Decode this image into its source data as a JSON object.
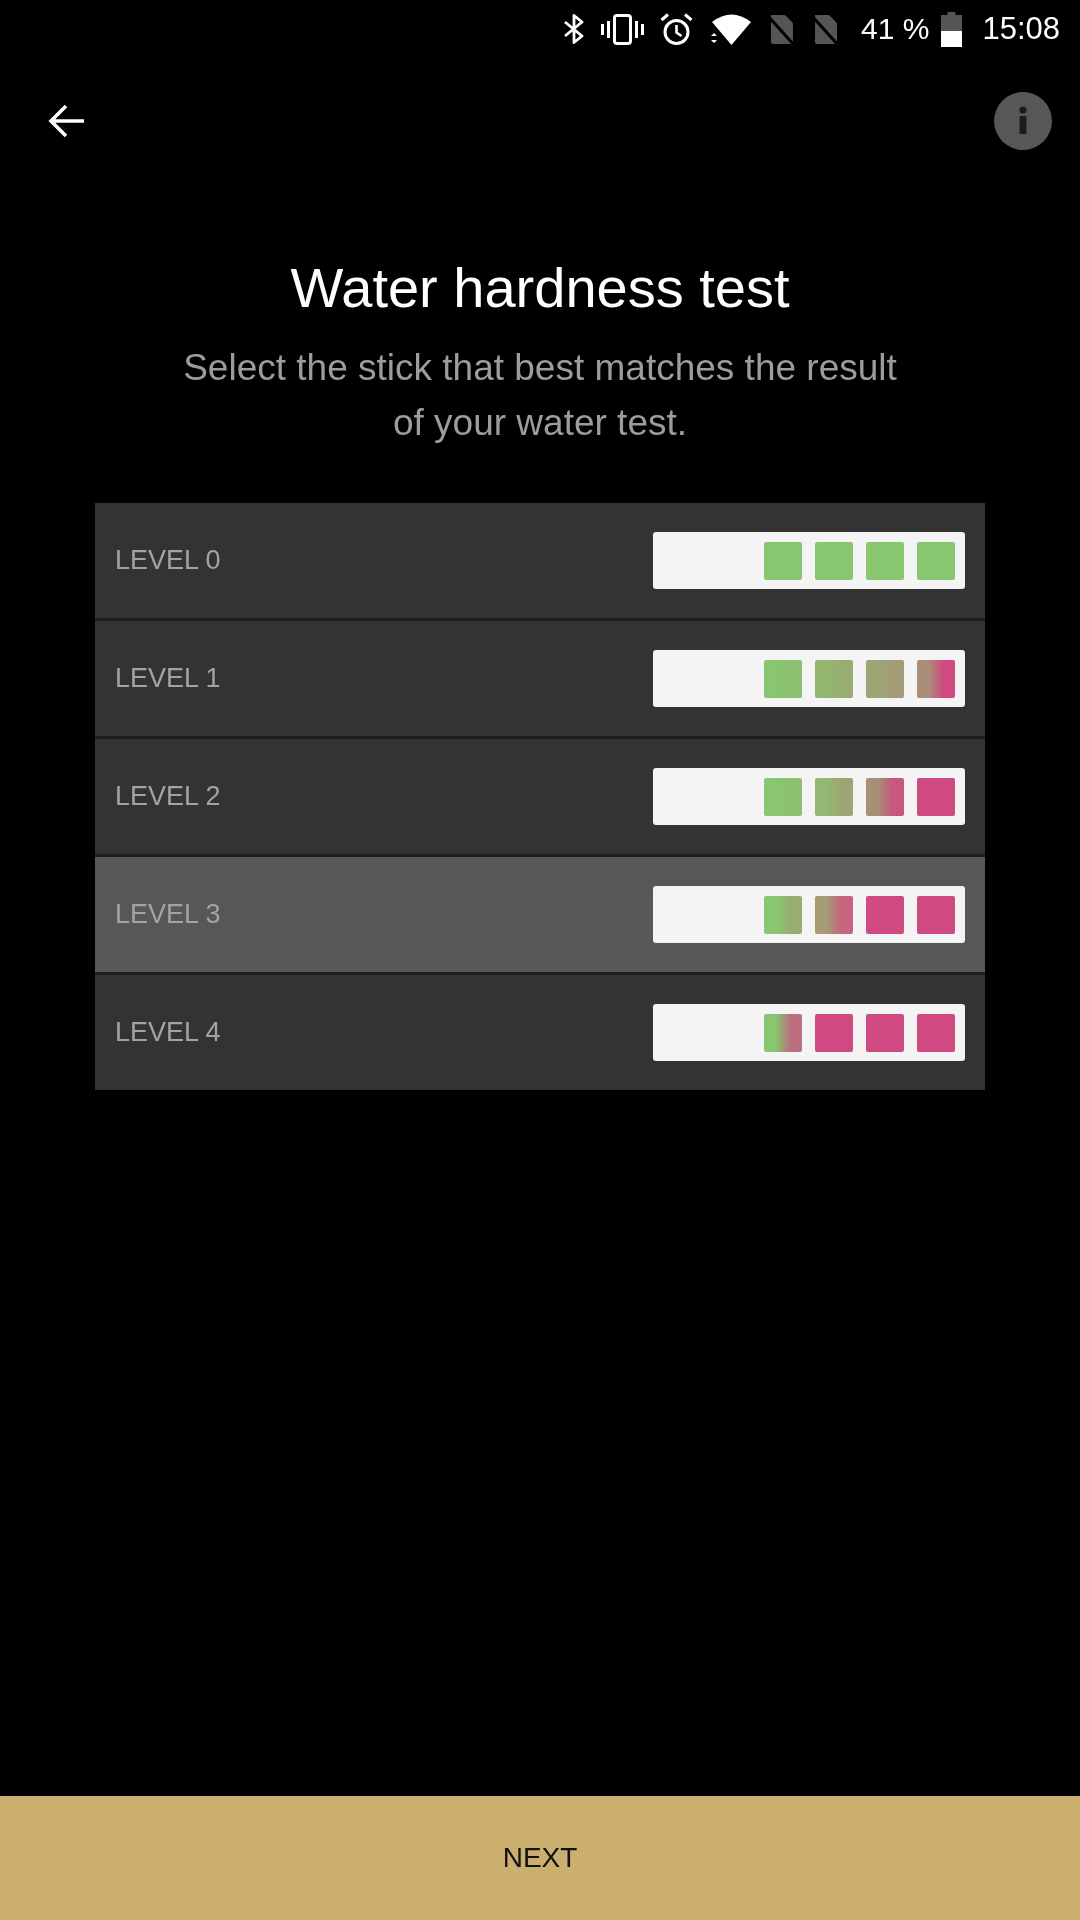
{
  "status_bar": {
    "battery_text": "41 %",
    "time": "15:08"
  },
  "title": "Water hardness test",
  "subtitle": "Select the stick that best matches the result of your water test.",
  "levels": [
    {
      "label": "LEVEL 0",
      "selected": false,
      "pads": [
        {
          "stops": [
            {
              "color": "#88c76f"
            }
          ]
        },
        {
          "stops": [
            {
              "color": "#88c76f"
            }
          ]
        },
        {
          "stops": [
            {
              "color": "#88c76f"
            }
          ]
        },
        {
          "stops": [
            {
              "color": "#88c76f"
            }
          ]
        }
      ]
    },
    {
      "label": "LEVEL 1",
      "selected": false,
      "pads": [
        {
          "stops": [
            {
              "color": "#88c76f"
            },
            {
              "color": "#8dc070"
            }
          ]
        },
        {
          "stops": [
            {
              "color": "#93b771"
            },
            {
              "color": "#99ad72"
            }
          ]
        },
        {
          "stops": [
            {
              "color": "#9ca673"
            },
            {
              "color": "#a39b75"
            }
          ]
        },
        {
          "stops": [
            {
              "color": "#a98f78"
            },
            {
              "color": "#cf4a80"
            }
          ]
        }
      ]
    },
    {
      "label": "LEVEL 2",
      "selected": false,
      "pads": [
        {
          "stops": [
            {
              "color": "#88c76f"
            },
            {
              "color": "#8cc270"
            }
          ]
        },
        {
          "stops": [
            {
              "color": "#92b871"
            },
            {
              "color": "#9ea574"
            }
          ]
        },
        {
          "stops": [
            {
              "color": "#a69177"
            },
            {
              "color": "#c7577f"
            }
          ]
        },
        {
          "stops": [
            {
              "color": "#cf4a80"
            }
          ]
        }
      ]
    },
    {
      "label": "LEVEL 3",
      "selected": true,
      "pads": [
        {
          "stops": [
            {
              "color": "#88c76f"
            },
            {
              "color": "#99ad72"
            }
          ]
        },
        {
          "stops": [
            {
              "color": "#a59b75"
            },
            {
              "color": "#c7647f"
            }
          ]
        },
        {
          "stops": [
            {
              "color": "#cf4a80"
            }
          ]
        },
        {
          "stops": [
            {
              "color": "#cf4a80"
            }
          ]
        }
      ]
    },
    {
      "label": "LEVEL 4",
      "selected": false,
      "pads": [
        {
          "stops": [
            {
              "color": "#88c76f"
            },
            {
              "color": "#bb6f80"
            }
          ]
        },
        {
          "stops": [
            {
              "color": "#cf4a80"
            }
          ]
        },
        {
          "stops": [
            {
              "color": "#cf4a80"
            }
          ]
        },
        {
          "stops": [
            {
              "color": "#cf4a80"
            }
          ]
        }
      ]
    }
  ],
  "next_button": {
    "label": "NEXT"
  }
}
